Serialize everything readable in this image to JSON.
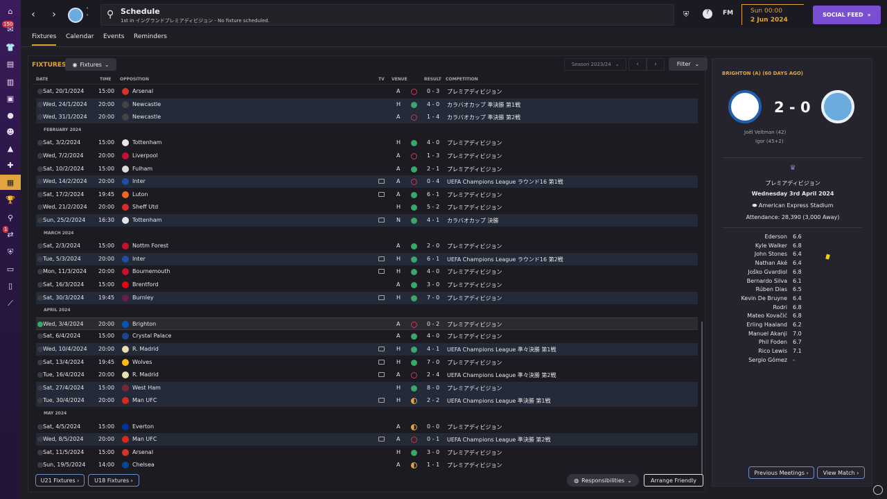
{
  "topbar": {
    "title": "Schedule",
    "subtitle": "1st in イングランドプレミアディビジョン - No fixture scheduled.",
    "fm_label": "FM",
    "date_time": "Sun 00:00",
    "date_day": "2 Jun 2024",
    "social_label": "SOCIAL FEED",
    "sidebar_badge_1": "150",
    "sidebar_badge_2": "1"
  },
  "subnav": {
    "tabs": [
      "Fixtures",
      "Calendar",
      "Events",
      "Reminders"
    ],
    "active": "Fixtures"
  },
  "fixtures": {
    "title": "FIXTURES",
    "dropdown": "Fixtures",
    "season": "Season 2023/24",
    "filter": "Filter",
    "headers": {
      "date": "DATE",
      "time": "TIME",
      "opposition": "OPPOSITION",
      "tv": "TV",
      "venue": "VENUE",
      "result": "RESULT",
      "competition": "COMPETITION"
    },
    "months": [
      "FEBRUARY 2024",
      "MARCH 2024",
      "APRIL 2024",
      "MAY 2024"
    ],
    "rows": [
      {
        "date": "Sat, 20/1/2024",
        "time": "15:00",
        "opp": "Arsenal",
        "tv": false,
        "venue": "A",
        "res": "L",
        "score": "0 - 3",
        "comp": "プレミアディビジョン"
      },
      {
        "date": "Wed, 24/1/2024",
        "time": "20:00",
        "opp": "Newcastle",
        "tv": false,
        "venue": "H",
        "res": "W",
        "score": "4 - 0",
        "comp": "カラバオカップ 準決勝 第1戦"
      },
      {
        "date": "Wed, 31/1/2024",
        "time": "20:00",
        "opp": "Newcastle",
        "tv": false,
        "venue": "A",
        "res": "L",
        "score": "1 - 4",
        "comp": "カラバオカップ 準決勝 第2戦"
      },
      {
        "date": "Sat, 3/2/2024",
        "time": "15:00",
        "opp": "Tottenham",
        "tv": false,
        "venue": "H",
        "res": "W",
        "score": "4 - 0",
        "comp": "プレミアディビジョン"
      },
      {
        "date": "Wed, 7/2/2024",
        "time": "20:00",
        "opp": "Liverpool",
        "tv": false,
        "venue": "A",
        "res": "L",
        "score": "1 - 3",
        "comp": "プレミアディビジョン"
      },
      {
        "date": "Sat, 10/2/2024",
        "time": "15:00",
        "opp": "Fulham",
        "tv": false,
        "venue": "A",
        "res": "W",
        "score": "2 - 1",
        "comp": "プレミアディビジョン"
      },
      {
        "date": "Wed, 14/2/2024",
        "time": "20:00",
        "opp": "Inter",
        "tv": true,
        "venue": "A",
        "res": "L",
        "score": "0 - 4",
        "comp": "UEFA Champions League ラウンド16 第1戦"
      },
      {
        "date": "Sat, 17/2/2024",
        "time": "19:45",
        "opp": "Luton",
        "tv": true,
        "venue": "A",
        "res": "W",
        "score": "6 - 1",
        "comp": "プレミアディビジョン"
      },
      {
        "date": "Wed, 21/2/2024",
        "time": "20:00",
        "opp": "Sheff Utd",
        "tv": false,
        "venue": "H",
        "res": "W",
        "score": "5 - 2",
        "comp": "プレミアディビジョン"
      },
      {
        "date": "Sun, 25/2/2024",
        "time": "16:30",
        "opp": "Tottenham",
        "tv": true,
        "venue": "N",
        "res": "W",
        "score": "4 - 1",
        "comp": "カラバオカップ 決勝"
      },
      {
        "date": "Sat, 2/3/2024",
        "time": "15:00",
        "opp": "Nottm Forest",
        "tv": false,
        "venue": "A",
        "res": "W",
        "score": "2 - 0",
        "comp": "プレミアディビジョン"
      },
      {
        "date": "Tue, 5/3/2024",
        "time": "20:00",
        "opp": "Inter",
        "tv": true,
        "venue": "H",
        "res": "W",
        "score": "6 - 1",
        "comp": "UEFA Champions League ラウンド16 第2戦"
      },
      {
        "date": "Mon, 11/3/2024",
        "time": "20:00",
        "opp": "Bournemouth",
        "tv": true,
        "venue": "H",
        "res": "W",
        "score": "4 - 0",
        "comp": "プレミアディビジョン"
      },
      {
        "date": "Sat, 16/3/2024",
        "time": "15:00",
        "opp": "Brentford",
        "tv": false,
        "venue": "A",
        "res": "W",
        "score": "3 - 0",
        "comp": "プレミアディビジョン"
      },
      {
        "date": "Sat, 30/3/2024",
        "time": "19:45",
        "opp": "Burnley",
        "tv": true,
        "venue": "H",
        "res": "W",
        "score": "7 - 0",
        "comp": "プレミアディビジョン"
      },
      {
        "date": "Wed, 3/4/2024",
        "time": "20:00",
        "opp": "Brighton",
        "tv": false,
        "venue": "A",
        "res": "L",
        "score": "0 - 2",
        "comp": "プレミアディビジョン"
      },
      {
        "date": "Sat, 6/4/2024",
        "time": "15:00",
        "opp": "Crystal Palace",
        "tv": false,
        "venue": "A",
        "res": "W",
        "score": "4 - 0",
        "comp": "プレミアディビジョン"
      },
      {
        "date": "Wed, 10/4/2024",
        "time": "20:00",
        "opp": "R. Madrid",
        "tv": true,
        "venue": "H",
        "res": "W",
        "score": "4 - 1",
        "comp": "UEFA Champions League 準々決勝 第1戦"
      },
      {
        "date": "Sat, 13/4/2024",
        "time": "19:45",
        "opp": "Wolves",
        "tv": true,
        "venue": "H",
        "res": "W",
        "score": "7 - 0",
        "comp": "プレミアディビジョン"
      },
      {
        "date": "Tue, 16/4/2024",
        "time": "20:00",
        "opp": "R. Madrid",
        "tv": true,
        "venue": "A",
        "res": "L",
        "score": "2 - 4",
        "comp": "UEFA Champions League 準々決勝 第2戦"
      },
      {
        "date": "Sat, 27/4/2024",
        "time": "15:00",
        "opp": "West Ham",
        "tv": false,
        "venue": "H",
        "res": "W",
        "score": "8 - 0",
        "comp": "プレミアディビジョン"
      },
      {
        "date": "Tue, 30/4/2024",
        "time": "20:00",
        "opp": "Man UFC",
        "tv": true,
        "venue": "H",
        "res": "D",
        "score": "2 - 2",
        "comp": "UEFA Champions League 準決勝 第1戦"
      },
      {
        "date": "Sat, 4/5/2024",
        "time": "15:00",
        "opp": "Everton",
        "tv": false,
        "venue": "A",
        "res": "D",
        "score": "0 - 0",
        "comp": "プレミアディビジョン"
      },
      {
        "date": "Wed, 8/5/2024",
        "time": "20:00",
        "opp": "Man UFC",
        "tv": true,
        "venue": "A",
        "res": "L",
        "score": "0 - 1",
        "comp": "UEFA Champions League 準決勝 第2戦"
      },
      {
        "date": "Sat, 11/5/2024",
        "time": "15:00",
        "opp": "Arsenal",
        "tv": false,
        "venue": "H",
        "res": "W",
        "score": "3 - 0",
        "comp": "プレミアディビジョン"
      },
      {
        "date": "Sun, 19/5/2024",
        "time": "14:00",
        "opp": "Chelsea",
        "tv": false,
        "venue": "A",
        "res": "D",
        "score": "1 - 1",
        "comp": "プレミアディビジョン"
      }
    ],
    "buttons": {
      "u21": "U21 Fixtures",
      "u18": "U18 Fixtures",
      "responsibilities": "Responsibilities",
      "arrange": "Arrange Friendly"
    }
  },
  "match": {
    "title": "BRIGHTON (A) (60 DAYS AGO)",
    "score": "2 - 0",
    "scorers": [
      "Joël Veltman (42)",
      "Igor (45+2)"
    ],
    "competition": "プレミアディビジョン",
    "date": "Wednesday 3rd April 2024",
    "stadium": "American Express Stadium",
    "attendance": "Attendance: 28,390 (3,000 Away)",
    "ratings": [
      {
        "name": "Ederson",
        "rating": "6.6"
      },
      {
        "name": "Kyle Walker",
        "rating": "6.8"
      },
      {
        "name": "John Stones",
        "rating": "6.4"
      },
      {
        "name": "Nathan Aké",
        "rating": "6.4"
      },
      {
        "name": "Joško Gvardiol",
        "rating": "6.8"
      },
      {
        "name": "Bernardo Silva",
        "rating": "6.1"
      },
      {
        "name": "Rúben Dias",
        "rating": "6.5"
      },
      {
        "name": "Kevin De Bruyne",
        "rating": "6.4"
      },
      {
        "name": "Rodri",
        "rating": "6.8"
      },
      {
        "name": "Mateo Kovačić",
        "rating": "6.8"
      },
      {
        "name": "Erling Haaland",
        "rating": "6.2"
      },
      {
        "name": "Manuel Akanji",
        "rating": "7.0"
      },
      {
        "name": "Phil Foden",
        "rating": "6.7"
      },
      {
        "name": "Rico Lewis",
        "rating": "7.1"
      },
      {
        "name": "Sergio Gómez",
        "rating": "-"
      }
    ],
    "buttons": {
      "previous": "Previous Meetings",
      "view": "View Match"
    }
  },
  "colors": {
    "accent": "#e2a53e",
    "win": "#3aa66a",
    "loss": "#d9324b",
    "social": "#7b4fd4"
  }
}
